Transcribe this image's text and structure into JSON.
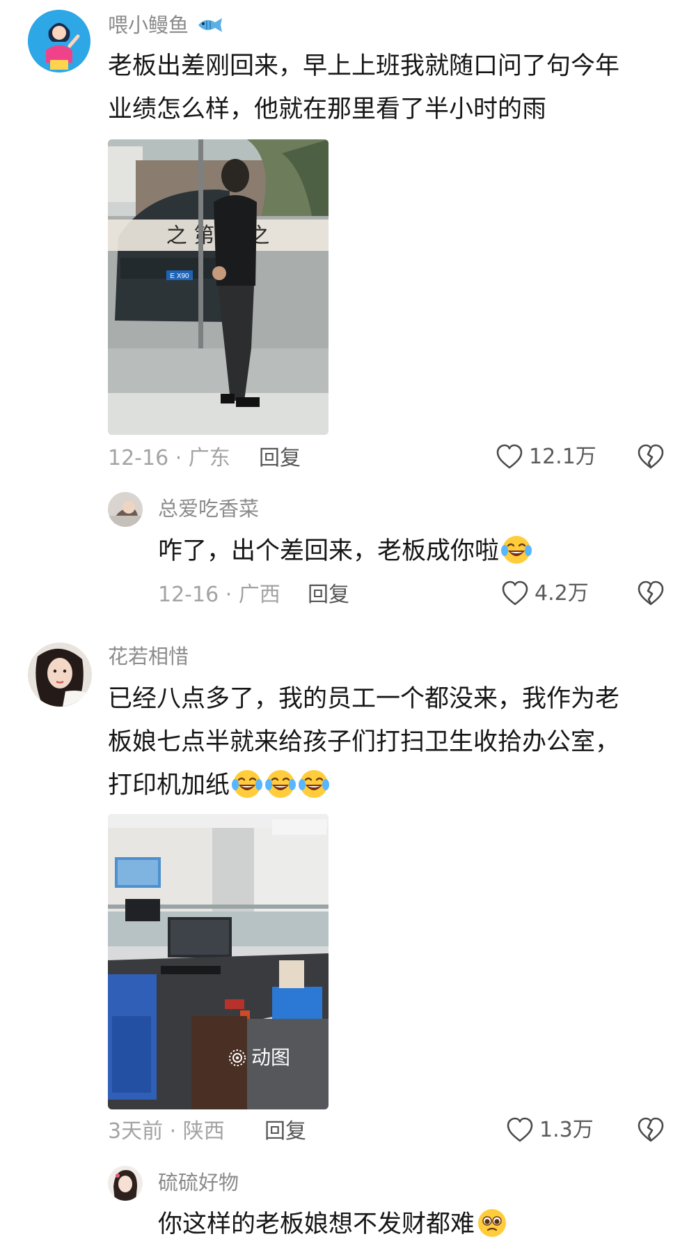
{
  "comments": [
    {
      "username": "喂小鳗鱼",
      "text_line1": "老板出差刚回来，早上上班我就随口问了句今年",
      "text_line2": "业绩怎么样，他就在那里看了半小时的雨",
      "date_location": "12-16 · 广东",
      "reply_label": "回复",
      "likes": "12.1万",
      "image_text": "之 第 的 之",
      "plate_text": "E X90",
      "reply": {
        "username": "总爱吃香菜",
        "text": "咋了，出个差回来，老板成你啦",
        "date_location": "12-16 · 广西",
        "reply_label": "回复",
        "likes": "4.2万"
      }
    },
    {
      "username": "花若相惜",
      "text_line1": "已经八点多了，我的员工一个都没来，我作为老",
      "text_line2": "板娘七点半就来给孩子们打扫卫生收拾办公室，",
      "text_line3": "打印机加纸",
      "image_badge": "动图",
      "date_location": "3天前 · 陕西",
      "reply_label": "回复",
      "likes": "1.3万",
      "reply": {
        "username": "硫硫好物",
        "text": "你这样的老板娘想不发财都难"
      }
    }
  ],
  "icons": [
    "fish-icon",
    "heart-icon",
    "broken-heart-icon",
    "crying-laughing-emoji",
    "pleading-emoji",
    "live-photo-icon"
  ],
  "colors": {
    "meta_gray": "#a3a3a3",
    "name_gray": "#8b8b8b",
    "text": "#161616"
  }
}
